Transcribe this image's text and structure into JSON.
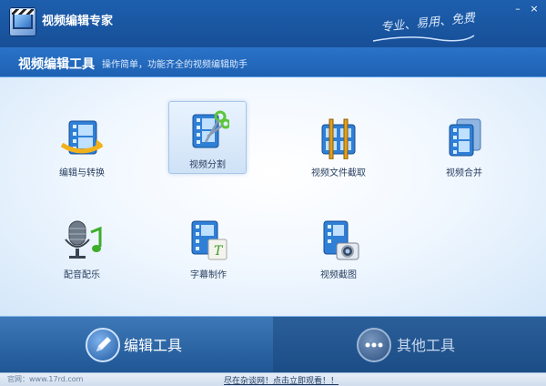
{
  "app": {
    "title": "视频编辑专家",
    "slogan": "专业、易用、免费"
  },
  "window_controls": {
    "minimize": "–",
    "close": "×"
  },
  "section": {
    "title": "视频编辑工具",
    "subtitle": "操作简单，功能齐全的视频编辑助手"
  },
  "tools": [
    {
      "label": "编辑与转换",
      "icon": "film-convert-icon"
    },
    {
      "label": "视频分割",
      "icon": "film-scissors-icon",
      "selected": true
    },
    {
      "label": "视频文件截取",
      "icon": "film-trim-icon"
    },
    {
      "label": "视频合并",
      "icon": "film-merge-icon"
    },
    {
      "label": "配音配乐",
      "icon": "microphone-music-icon"
    },
    {
      "label": "字幕制作",
      "icon": "film-subtitle-icon"
    },
    {
      "label": "视频截图",
      "icon": "film-camera-icon"
    }
  ],
  "bottom_tabs": [
    {
      "label": "编辑工具",
      "icon": "pencil-icon",
      "active": true
    },
    {
      "label": "其他工具",
      "icon": "dots-icon",
      "active": false
    }
  ],
  "footer": {
    "site": "官网：www.17rd.com",
    "promo": "尽在杂谈网！点击立即观看！！"
  },
  "colors": {
    "titlebar": "#174f97",
    "accent": "#2a78cc",
    "panel_light": "#f2f8ff",
    "bottom_bar": "#1b4c86"
  }
}
